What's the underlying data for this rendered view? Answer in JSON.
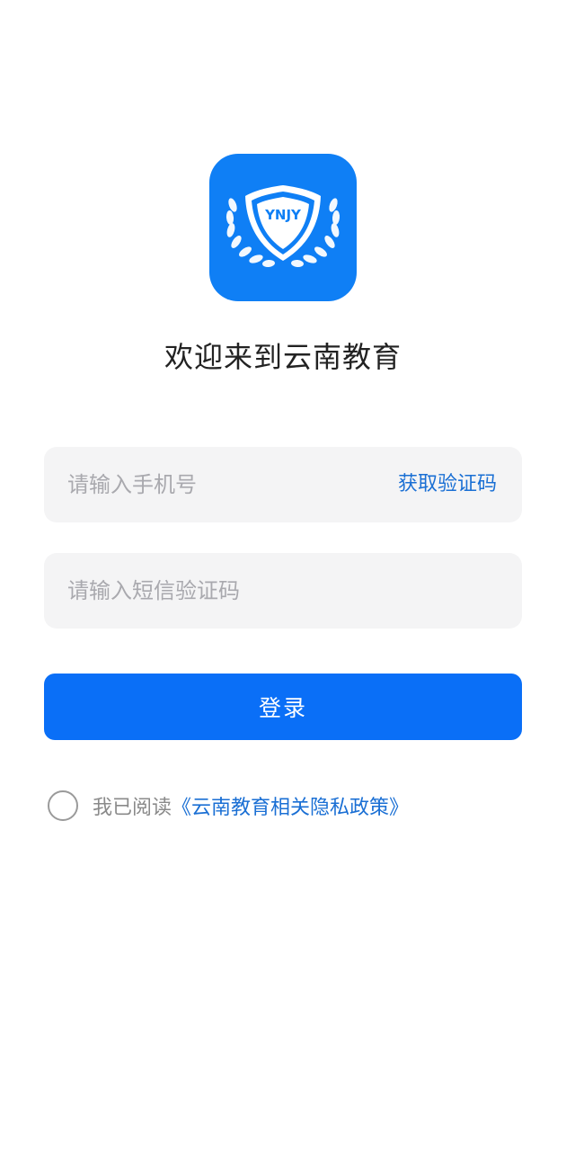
{
  "app": {
    "logo_text": "YNJY",
    "logo_color": "#0f7ff5",
    "welcome": "欢迎来到云南教育"
  },
  "form": {
    "phone_placeholder": "请输入手机号",
    "get_code_label": "获取验证码",
    "code_placeholder": "请输入短信验证码",
    "login_label": "登录"
  },
  "agreement": {
    "prefix": "我已阅读",
    "policy_link": "《云南教育相关隐私政策》",
    "checked": false
  },
  "colors": {
    "primary": "#0a6ff7",
    "link": "#1a6fd4",
    "field_bg": "#f4f4f5",
    "placeholder": "#a9a9ae"
  }
}
